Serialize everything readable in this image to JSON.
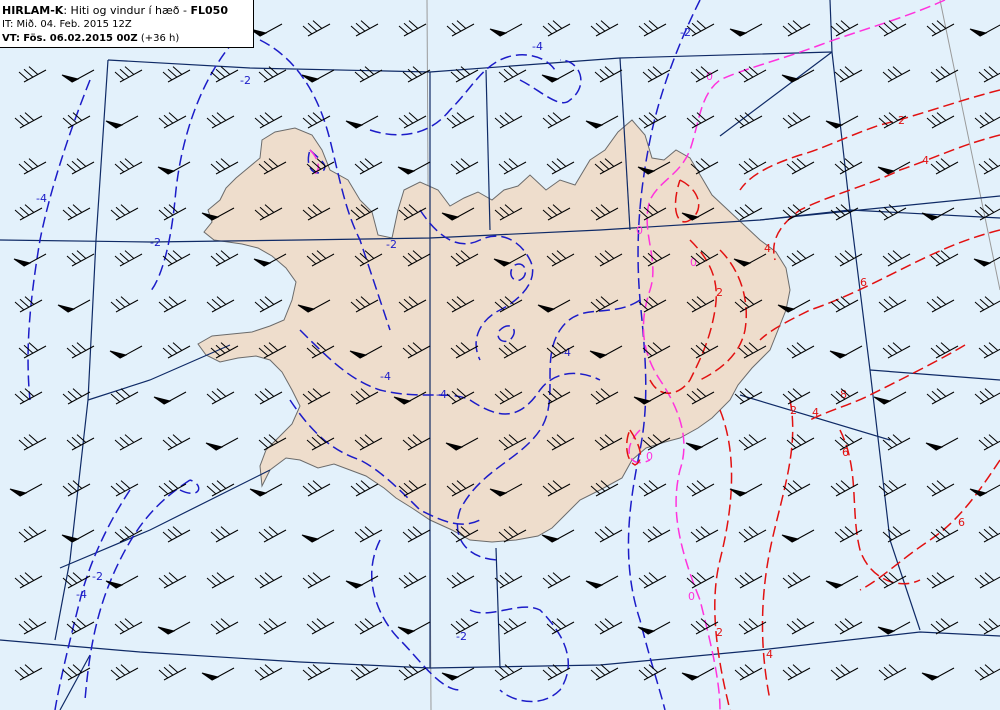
{
  "header": {
    "model": "HIRLAM-K",
    "separator": ":",
    "description": "Hiti og vindur í hæð",
    "dash": "-",
    "level": "FL050",
    "init_label": "IT:",
    "init_time": "Mið. 04. Feb. 2015 12Z",
    "valid_label": "VT:",
    "valid_time": "Fös. 06.02.2015 00Z",
    "lead": "(+36 h)"
  },
  "colors": {
    "sea": "#e3f1fb",
    "land": "#eeddcc",
    "coast": "#6b6b6b",
    "grid_lines": "#0f2a66",
    "meridians": "#999999",
    "cold_isotherms": "#1c1cc8",
    "zero_isotherm": "#ff33dd",
    "warm_isotherms": "#e21111",
    "wind_barbs": "#000000"
  },
  "wind_barb_style": "three full barbs and pennant flags, pointing from the west/northwest over the whole domain",
  "isotherm_labels": [
    {
      "id": "cold-neg2-nw",
      "text": "-2",
      "color": "cold"
    },
    {
      "id": "cold-neg4-nw",
      "text": "-4",
      "color": "cold"
    },
    {
      "id": "cold-neg2-n",
      "text": "-2",
      "color": "cold"
    },
    {
      "id": "cold-neg4-n",
      "text": "-4",
      "color": "cold"
    },
    {
      "id": "cold-neg2-west",
      "text": "-2",
      "color": "cold"
    },
    {
      "id": "cold-neg4-central",
      "text": "-4",
      "color": "cold"
    },
    {
      "id": "cold-neg4-west2",
      "text": "-4",
      "color": "cold"
    },
    {
      "id": "cold-neg4-sw",
      "text": "-4",
      "color": "cold"
    },
    {
      "id": "cold-neg2-sw",
      "text": "-2",
      "color": "cold"
    },
    {
      "id": "cold-neg4-south",
      "text": "-4",
      "color": "cold"
    },
    {
      "id": "cold-neg2-south",
      "text": "-2",
      "color": "cold"
    },
    {
      "id": "cold-neg2-s2",
      "text": "-2",
      "color": "cold"
    },
    {
      "id": "zero-ne",
      "text": "0",
      "color": "zero"
    },
    {
      "id": "zero-east",
      "text": "0",
      "color": "zero"
    },
    {
      "id": "zero-se",
      "text": "0",
      "color": "zero"
    },
    {
      "id": "zero-south",
      "text": "0",
      "color": "zero"
    },
    {
      "id": "zero-e2",
      "text": "0",
      "color": "zero"
    },
    {
      "id": "warm-2-ne",
      "text": "2",
      "color": "warm"
    },
    {
      "id": "warm-4-ne",
      "text": "4",
      "color": "warm"
    },
    {
      "id": "warm-6-e",
      "text": "6",
      "color": "warm"
    },
    {
      "id": "warm-8-e",
      "text": "8",
      "color": "warm"
    },
    {
      "id": "warm-2-e",
      "text": "2",
      "color": "warm"
    },
    {
      "id": "warm-4-e",
      "text": "4",
      "color": "warm"
    },
    {
      "id": "warm-6-se",
      "text": "6",
      "color": "warm"
    },
    {
      "id": "warm-6-se2",
      "text": "6",
      "color": "warm"
    },
    {
      "id": "warm-2-s",
      "text": "2",
      "color": "warm"
    },
    {
      "id": "warm-4-s",
      "text": "4",
      "color": "warm"
    },
    {
      "id": "warm-2-east-land",
      "text": "2",
      "color": "warm"
    },
    {
      "id": "warm-4-east-land",
      "text": "4",
      "color": "warm"
    }
  ]
}
